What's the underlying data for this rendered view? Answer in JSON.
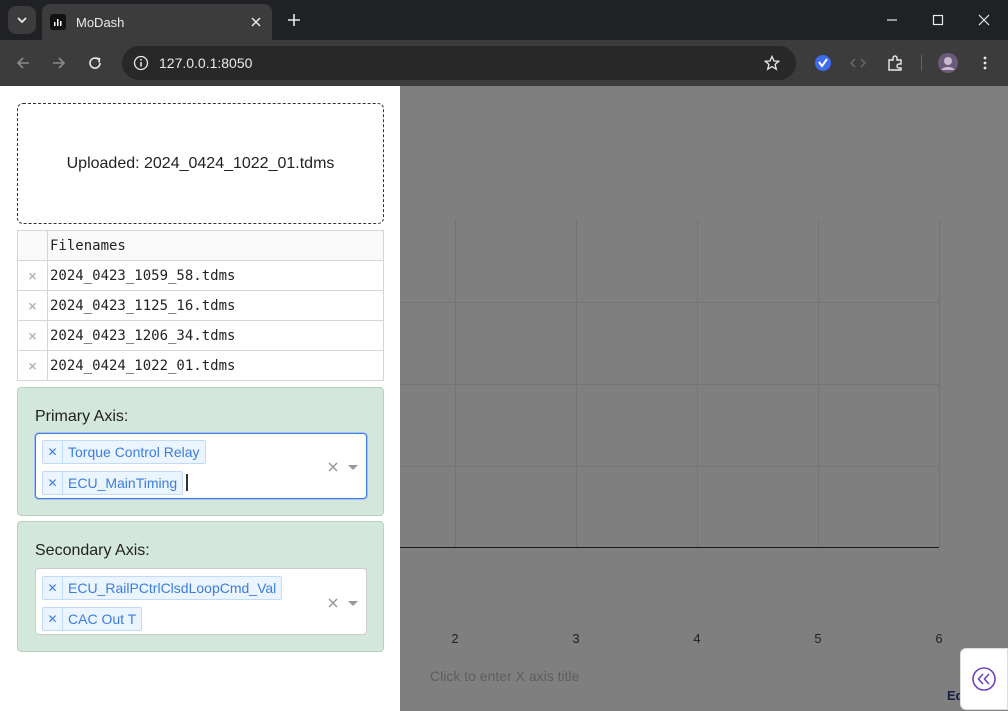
{
  "browser": {
    "tab_title": "MoDash",
    "url": "127.0.0.1:8050"
  },
  "upload": {
    "status": "Uploaded: 2024_0424_1022_01.tdms"
  },
  "files_table": {
    "header": "Filenames",
    "delete_glyph": "×",
    "rows": [
      "2024_0423_1059_58.tdms",
      "2024_0423_1125_16.tdms",
      "2024_0423_1206_34.tdms",
      "2024_0424_1022_01.tdms"
    ]
  },
  "primary_axis": {
    "label": "Primary Axis:",
    "selected": [
      "Torque Control Relay",
      "ECU_MainTiming"
    ]
  },
  "secondary_axis": {
    "label": "Secondary Axis:",
    "selected": [
      "ECU_RailPCtrlClsdLoopCmd_Val",
      "CAC Out T"
    ]
  },
  "chart": {
    "x_ticks": [
      "2",
      "3",
      "4",
      "5",
      "6"
    ],
    "x_title_placeholder": "Click to enter X axis title",
    "edit_link": "Ed"
  },
  "colors": {
    "accent": "#3b7ddd",
    "panel": "#d4e7dc",
    "collapse_icon": "#6f42c1"
  }
}
